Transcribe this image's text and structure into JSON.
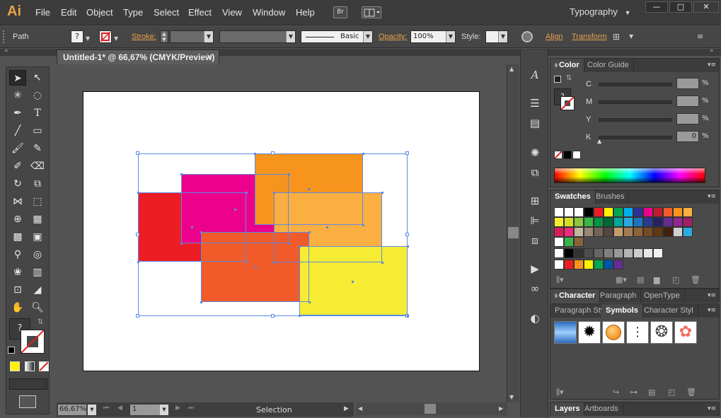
{
  "app": {
    "logo": "Ai",
    "workspace": "Typography"
  },
  "menu": [
    "File",
    "Edit",
    "Object",
    "Type",
    "Select",
    "Effect",
    "View",
    "Window",
    "Help"
  ],
  "menubar_icons": {
    "bridge": "Br",
    "arrange": "arrange-documents-icon"
  },
  "window_buttons": {
    "minimize": "—",
    "maximize": "□",
    "close": "✕"
  },
  "control_bar": {
    "object_type": "Path",
    "stroke_label": "Stroke:",
    "stroke_profile": "Basic",
    "opacity_label": "Opacity:",
    "opacity_value": "100%",
    "style_label": "Style:",
    "align_label": "Align",
    "transform_label": "Transform"
  },
  "document": {
    "tab_title": "Untitled-1* @ 66,67% (CMYK/Preview)",
    "close": "×"
  },
  "status": {
    "zoom": "66,67%",
    "page": "1",
    "tool": "Selection"
  },
  "artwork": {
    "colors": {
      "red": "#ee1c24",
      "magenta": "#ec008c",
      "orange": "#f7941d",
      "light_orange": "#fbaf41",
      "red_orange": "#f15a29",
      "yellow": "#f7ec34"
    }
  },
  "color_panel": {
    "tabs": [
      "Color",
      "Color Guide"
    ],
    "channels": [
      {
        "name": "C",
        "value": "",
        "pct": "%"
      },
      {
        "name": "M",
        "value": "",
        "pct": "%"
      },
      {
        "name": "Y",
        "value": "",
        "pct": "%"
      },
      {
        "name": "K",
        "value": "0",
        "pct": "%"
      }
    ]
  },
  "swatches_panel": {
    "tabs": [
      "Swatches",
      "Brushes"
    ],
    "rows": [
      [
        "#ffffff",
        "#ffffff",
        "#ffffff",
        "#000000",
        "#ee1c24",
        "#fff200",
        "#00a651",
        "#00aeef",
        "#2e3192",
        "#ec008c",
        "#be1e2d",
        "#f15a29",
        "#f7941d",
        "#fbaf41"
      ],
      [
        "#f7ec34",
        "#d7df23",
        "#8dc63f",
        "#39b54a",
        "#009444",
        "#006838",
        "#00a79d",
        "#27aae1",
        "#1c75bc",
        "#2b3990",
        "#262262",
        "#662d91",
        "#92278f",
        "#9e1f63"
      ],
      [
        "#da1c5c",
        "#ee2a7b",
        "#c2b59b",
        "#998675",
        "#736357",
        "#534741",
        "#c69c6d",
        "#a67c52",
        "#8c6239",
        "#754c24",
        "#603813",
        "#42210b",
        "#d0d0d0",
        "#29abe2"
      ],
      [
        "#ffffff",
        "#39b54a",
        "#8c6239"
      ],
      [
        "#ffffff",
        "#000000",
        "#333333",
        "#4d4d4d",
        "#666666",
        "#808080",
        "#999999",
        "#b3b3b3",
        "#cccccc",
        "#e6e6e6",
        "#f2f2f2"
      ],
      [
        "#ffffff",
        "#ee1c24",
        "#f7941d",
        "#fff200",
        "#00a651",
        "#0054a6",
        "#662d91"
      ]
    ]
  },
  "character_panel": {
    "tabs": [
      "Character",
      "Paragraph",
      "OpenType"
    ]
  },
  "symbols_panel": {
    "tabs": [
      "Paragraph Sty",
      "Symbols",
      "Character Styl"
    ]
  },
  "layers_panel": {
    "tabs": [
      "Layers",
      "Artboards"
    ]
  }
}
